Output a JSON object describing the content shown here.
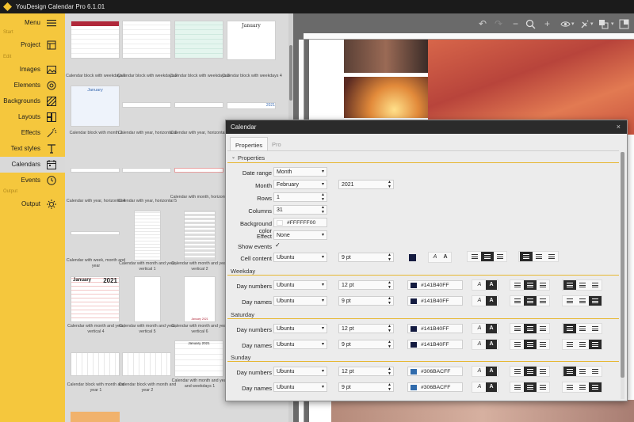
{
  "app": {
    "title": "YouDesign Calendar Pro 6.1.01"
  },
  "sidebar": {
    "menu_label": "Menu",
    "sections": {
      "start": "Start",
      "edit": "Edit",
      "output": "Output"
    },
    "items": [
      {
        "label": "Project",
        "icon": "project-icon"
      },
      {
        "label": "Images",
        "icon": "image-icon"
      },
      {
        "label": "Elements",
        "icon": "elements-icon"
      },
      {
        "label": "Backgrounds",
        "icon": "backgrounds-icon"
      },
      {
        "label": "Layouts",
        "icon": "layouts-icon"
      },
      {
        "label": "Effects",
        "icon": "effects-icon"
      },
      {
        "label": "Text styles",
        "icon": "text-styles-icon"
      },
      {
        "label": "Calendars",
        "icon": "calendars-icon"
      },
      {
        "label": "Events",
        "icon": "events-icon"
      },
      {
        "label": "Output",
        "icon": "output-icon"
      }
    ],
    "accent": "#F5C73D"
  },
  "thumbnails": [
    {
      "caption": "Calendar block with weekdays 1"
    },
    {
      "caption": "Calendar block with weekdays 2"
    },
    {
      "caption": "Calendar block with weekdays 3"
    },
    {
      "caption": "Calendar block with weekdays 4",
      "thumb_text": "January"
    },
    {
      "caption": "Calendar block with month 2",
      "thumb_text": "January"
    },
    {
      "caption": "Calendar with year, horizontal 1"
    },
    {
      "caption": "Calendar with year, horizontal 2"
    },
    {
      "caption": "",
      "thumb_text": "2021"
    },
    {
      "caption": "Calendar with year, horizontal 4"
    },
    {
      "caption": "Calendar with year, horizontal 5"
    },
    {
      "caption": "Calendar with month, horizontal"
    },
    {
      "caption": "Calendar with week, month and year"
    },
    {
      "caption": "Calendar with month and year, vertical 1"
    },
    {
      "caption": "Calendar with month and year, vertical 2"
    },
    {
      "caption": "Calendar with month and year, vertical 4",
      "thumb_text": "January",
      "thumb_text2": "2021"
    },
    {
      "caption": "Calendar with month and year, vertical 5"
    },
    {
      "caption": "Calendar with month and year, vertical 6",
      "thumb_text": "January 2021"
    },
    {
      "caption": "Calendar block with month and year 1"
    },
    {
      "caption": "Calendar block with month and year 2"
    },
    {
      "caption": "Calendar with month and year and weekdays 1",
      "thumb_text": "January 2021"
    }
  ],
  "dialog": {
    "title": "Calendar",
    "close": "×",
    "tabs": [
      "Properties",
      "Pro"
    ],
    "section_properties": "Properties",
    "fields": {
      "date_range": {
        "label": "Date range",
        "value": "Month"
      },
      "month": {
        "label": "Month",
        "value": "February",
        "year": "2021"
      },
      "rows": {
        "label": "Rows",
        "value": "1"
      },
      "columns": {
        "label": "Columns",
        "value": "31"
      },
      "background_color": {
        "label": "Background color",
        "value": "#FFFFFF00"
      },
      "effect": {
        "label": "Effect",
        "value": "None"
      },
      "show_events": {
        "label": "Show events",
        "value": "✓"
      },
      "cell_content": {
        "label": "Cell content",
        "font": "Ubuntu",
        "size": "9 pt"
      }
    },
    "groups": [
      {
        "title": "Weekday",
        "rows": [
          {
            "label": "Day numbers",
            "font": "Ubuntu",
            "size": "12 pt",
            "color": "#141B40FF",
            "swatch": "#141B40"
          },
          {
            "label": "Day names",
            "font": "Ubuntu",
            "size": "9 pt",
            "color": "#141B40FF",
            "swatch": "#141B40"
          }
        ]
      },
      {
        "title": "Saturday",
        "rows": [
          {
            "label": "Day numbers",
            "font": "Ubuntu",
            "size": "12 pt",
            "color": "#141B40FF",
            "swatch": "#141B40"
          },
          {
            "label": "Day names",
            "font": "Ubuntu",
            "size": "9 pt",
            "color": "#141B40FF",
            "swatch": "#141B40"
          }
        ]
      },
      {
        "title": "Sunday",
        "rows": [
          {
            "label": "Day numbers",
            "font": "Ubuntu",
            "size": "12 pt",
            "color": "#306BACFF",
            "swatch": "#306BAC"
          },
          {
            "label": "Day names",
            "font": "Ubuntu",
            "size": "9 pt",
            "color": "#306BACFF",
            "swatch": "#306BAC"
          }
        ]
      }
    ],
    "font_size_glyphs": [
      "A",
      "A"
    ],
    "cell_color": "#141B40"
  }
}
